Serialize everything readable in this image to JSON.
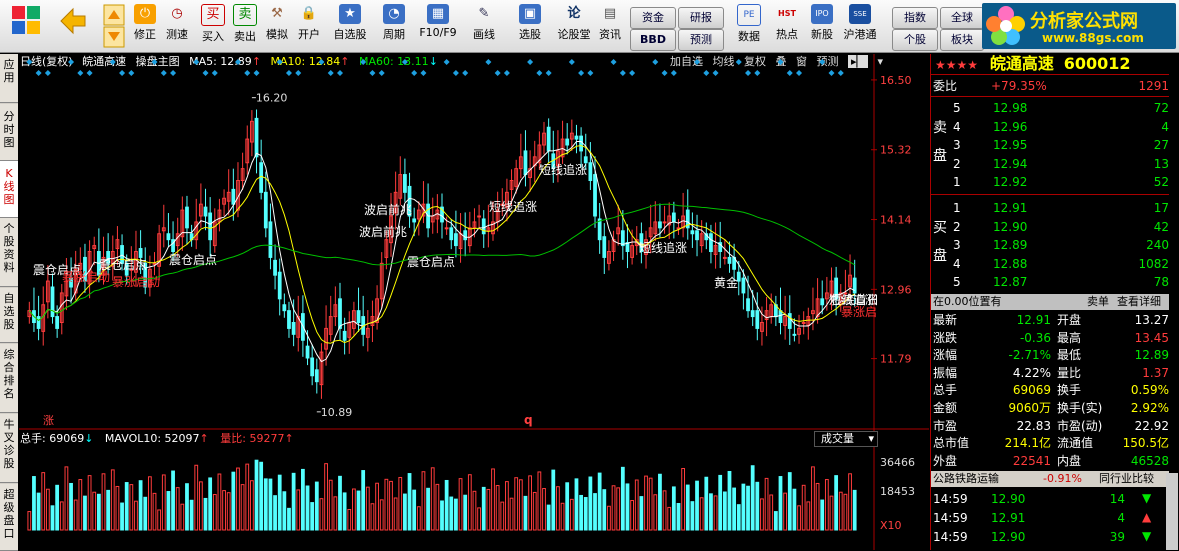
{
  "toolbar": {
    "buttons": [
      {
        "label": "修正"
      },
      {
        "label": "测速"
      },
      {
        "label": "买入"
      },
      {
        "label": "卖出"
      },
      {
        "label": "模拟"
      },
      {
        "label": "开户"
      },
      {
        "label": "自选股"
      },
      {
        "label": "周期"
      },
      {
        "label": "F10/F9"
      },
      {
        "label": "画线"
      },
      {
        "label": "选股"
      },
      {
        "label": "论股堂"
      },
      {
        "label": "资讯"
      },
      {
        "label": "数据"
      },
      {
        "label": "热点"
      },
      {
        "label": "新股"
      },
      {
        "label": "沪港通"
      }
    ],
    "icon_texts": {
      "buy": "买",
      "sell": "卖",
      "lun": "论",
      "pe": "PE",
      "hst": "HST",
      "ipo": "IPO",
      "sse": "SSE"
    },
    "small_buttons": [
      "资金",
      "BBD",
      "研报",
      "预测",
      "指数",
      "个股",
      "全球",
      "板块"
    ],
    "logo": {
      "title": "分析家公式网",
      "url": "www.88gs.com"
    }
  },
  "left_tabs": [
    {
      "label": "应用"
    },
    {
      "label": "分时图"
    },
    {
      "label": "K线图"
    },
    {
      "label": "个股资料"
    },
    {
      "label": "自选股"
    },
    {
      "label": "综合排名"
    },
    {
      "label": "牛叉诊股"
    },
    {
      "label": "超级盘口"
    }
  ],
  "chart": {
    "title_left": "日线(复权)",
    "stock_name": "皖通高速",
    "chart_mode": "操盘主图",
    "ma5": "MA5: 12.89",
    "ma10": "MA10: 12.84",
    "ma60": "MA60: 13.11",
    "top_buttons": [
      "加自选",
      "均线",
      "复权",
      "叠",
      "窗",
      "预测"
    ],
    "price_labels": [
      "16.50",
      "15.32",
      "14.14",
      "12.96",
      "11.79"
    ],
    "high_label": "16.20",
    "low_label": "10.89",
    "annotations": [
      "震仓启点",
      "震仓启点",
      "震仓启点",
      "暴涨启动",
      "暴涨启动",
      "波启前兆",
      "波启前兆",
      "震仓启点",
      "短线追涨",
      "短线追涨",
      "短线追涨",
      "黄金",
      "短线追涨",
      "抄底首日",
      "暴涨启"
    ],
    "mark_zhang": "涨",
    "mark_q": "q",
    "volume": {
      "total": "总手: 69069",
      "mavol": "MAVOL10: 52097",
      "ratio": "量比: 59277",
      "selector": "成交量",
      "labels": [
        "36466",
        "18453",
        "X10"
      ]
    }
  },
  "chart_data": {
    "type": "candlestick",
    "close": [
      12.6,
      12.4,
      12.3,
      12.7,
      13.1,
      12.5,
      12.3,
      12.9,
      13.1,
      13.0,
      13.3,
      13.4,
      13.1,
      13.6,
      13.7,
      13.2,
      13.5,
      13.4,
      13.6,
      13.8,
      13.4,
      13.2,
      13.3,
      13.6,
      13.5,
      13.0,
      13.3,
      13.4,
      13.9,
      14.0,
      13.8,
      13.6,
      13.9,
      14.3,
      14.0,
      13.8,
      14.1,
      14.4,
      14.2,
      13.8,
      14.1,
      14.3,
      14.5,
      14.6,
      14.4,
      14.8,
      15.0,
      15.5,
      15.8,
      15.2,
      14.6,
      14.0,
      13.5,
      13.2,
      12.8,
      12.6,
      12.3,
      12.2,
      12.5,
      12.1,
      11.8,
      11.5,
      11.4,
      11.9,
      12.3,
      12.5,
      12.7,
      12.3,
      12.1,
      12.4,
      12.6,
      12.4,
      12.2,
      12.3,
      12.5,
      12.8,
      13.4,
      13.8,
      14.2,
      14.6,
      14.9,
      14.6,
      14.2,
      14.1,
      14.3,
      14.4,
      14.0,
      14.2,
      14.3,
      14.1,
      14.0,
      13.8,
      13.7,
      13.9,
      13.8,
      14.0,
      14.1,
      14.2,
      13.9,
      14.0,
      14.1,
      14.3,
      14.4,
      14.6,
      14.8,
      15.0,
      15.2,
      14.9,
      15.0,
      15.2,
      15.4,
      15.6,
      15.3,
      15.0,
      15.3,
      15.5,
      15.4,
      15.6,
      15.5,
      15.3,
      15.1,
      14.8,
      14.2,
      13.8,
      13.5,
      13.6,
      13.8,
      14.0,
      13.7,
      13.6,
      13.7,
      13.8,
      13.6,
      13.8,
      14.0,
      14.1,
      14.0,
      14.1,
      14.2,
      14.1,
      14.0,
      14.2,
      14.0,
      13.9,
      13.8,
      13.9,
      13.8,
      13.6,
      13.7,
      13.6,
      13.5,
      13.4,
      13.3,
      13.1,
      12.9,
      12.6,
      12.5,
      12.3,
      12.4,
      12.6,
      12.7,
      12.5,
      12.4,
      12.5,
      12.3,
      12.2,
      12.3,
      12.4,
      12.5,
      12.6,
      12.8,
      12.7,
      12.9,
      13.1,
      12.8,
      12.9,
      12.9,
      13.2,
      12.9
    ],
    "y_range": [
      10.6,
      16.6
    ],
    "x_axis": "trading days",
    "volume_range": [
      0,
      36466
    ]
  },
  "right_panel": {
    "stars": "★★★★",
    "stock_name": "皖通高速",
    "code": "600012",
    "weibi_label": "委比",
    "weibi_value": "+79.35%",
    "weibi_diff": "1291",
    "sell_label": "卖盘",
    "buy_label": "买盘",
    "sell": [
      {
        "lvl": "5",
        "price": "12.98",
        "vol": "72"
      },
      {
        "lvl": "4",
        "price": "12.96",
        "vol": "4"
      },
      {
        "lvl": "3",
        "price": "12.95",
        "vol": "27"
      },
      {
        "lvl": "2",
        "price": "12.94",
        "vol": "13"
      },
      {
        "lvl": "1",
        "price": "12.92",
        "vol": "52"
      }
    ],
    "buy": [
      {
        "lvl": "1",
        "price": "12.91",
        "vol": "17"
      },
      {
        "lvl": "2",
        "price": "12.90",
        "vol": "42"
      },
      {
        "lvl": "3",
        "price": "12.89",
        "vol": "240"
      },
      {
        "lvl": "4",
        "price": "12.88",
        "vol": "1082"
      },
      {
        "lvl": "5",
        "price": "12.87",
        "vol": "78"
      }
    ],
    "position_text": "在0.00位置有",
    "sell_single": "卖单",
    "view_detail": "查看详细",
    "stats": [
      {
        "l1": "最新",
        "v1": "12.91",
        "c1": "green",
        "l2": "开盘",
        "v2": "13.27",
        "c2": "white"
      },
      {
        "l1": "涨跌",
        "v1": "-0.36",
        "c1": "green",
        "l2": "最高",
        "v2": "13.45",
        "c2": "red"
      },
      {
        "l1": "涨幅",
        "v1": "-2.71%",
        "c1": "green",
        "l2": "最低",
        "v2": "12.89",
        "c2": "green"
      },
      {
        "l1": "振幅",
        "v1": "4.22%",
        "c1": "white",
        "l2": "量比",
        "v2": "1.37",
        "c2": "red"
      },
      {
        "l1": "总手",
        "v1": "69069",
        "c1": "yellow",
        "l2": "换手",
        "v2": "0.59%",
        "c2": "yellow"
      },
      {
        "l1": "金额",
        "v1": "9060万",
        "c1": "yellow",
        "l2": "换手(实)",
        "v2": "2.92%",
        "c2": "yellow"
      },
      {
        "l1": "市盈",
        "v1": "22.83",
        "c1": "white",
        "l2": "市盈(动)",
        "v2": "22.92",
        "c2": "white"
      },
      {
        "l1": "总市值",
        "v1": "214.1亿",
        "c1": "yellow",
        "l2": "流通值",
        "v2": "150.5亿",
        "c2": "yellow"
      },
      {
        "l1": "外盘",
        "v1": "22541",
        "c1": "red",
        "l2": "内盘",
        "v2": "46528",
        "c2": "green"
      }
    ],
    "sector_name": "公路铁路运输",
    "sector_change": "-0.91%",
    "peer_compare": "同行业比较",
    "ticks": [
      {
        "time": "14:59",
        "price": "12.90",
        "vol": "14",
        "dir": "down"
      },
      {
        "time": "14:59",
        "price": "12.91",
        "vol": "4",
        "dir": "up"
      },
      {
        "time": "14:59",
        "price": "12.90",
        "vol": "39",
        "dir": "down"
      }
    ]
  }
}
